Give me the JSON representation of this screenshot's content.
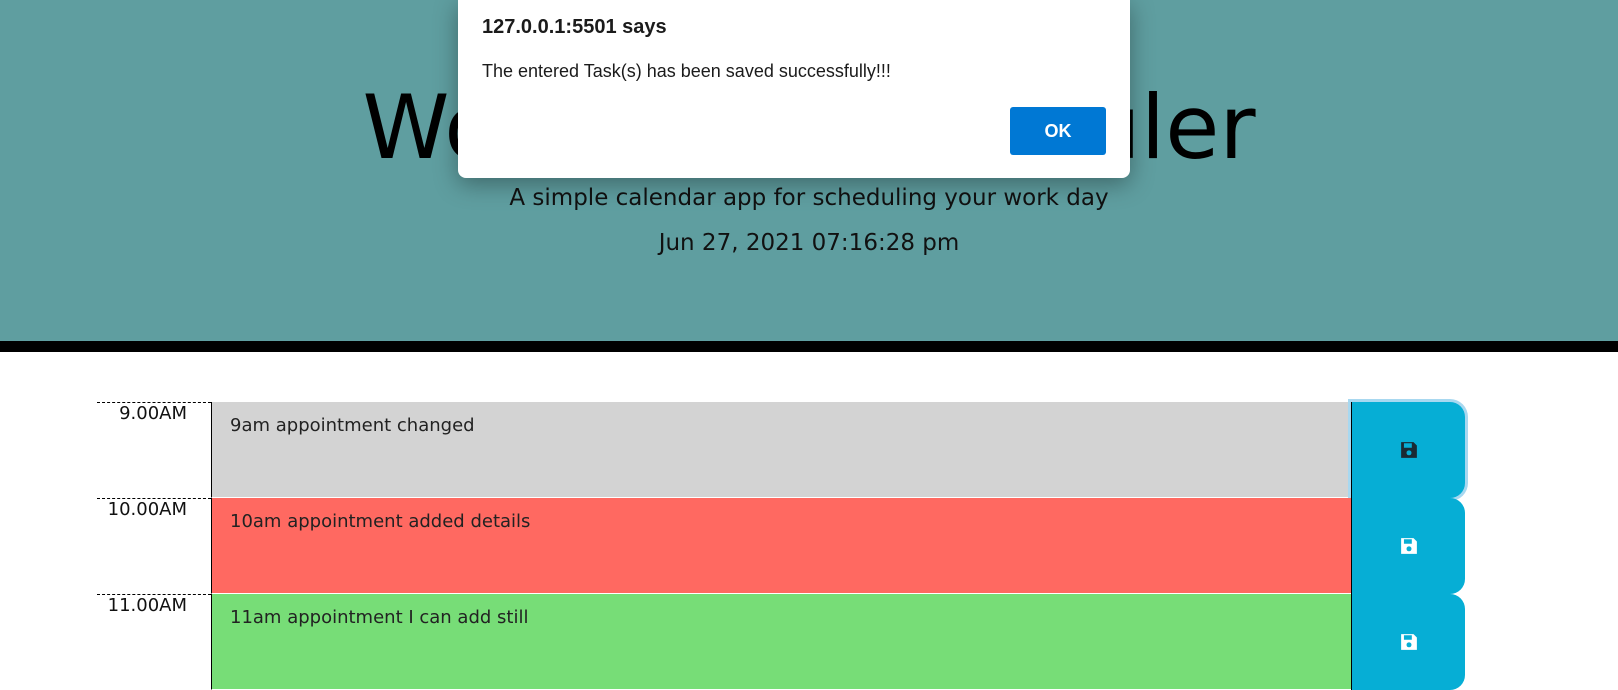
{
  "header": {
    "title": "Work Day Scheduler",
    "subtitle": "A simple calendar app for scheduling your work day",
    "current_datetime": "Jun 27, 2021 07:16:28 pm"
  },
  "dialog": {
    "title": "127.0.0.1:5501 says",
    "message": "The entered Task(s) has been saved successfully!!!",
    "ok_label": "OK",
    "accent_color": "#0078d4"
  },
  "colors": {
    "header_bg": "#5f9ea0",
    "past": "#d3d3d3",
    "present": "#ff6961",
    "future": "#77dd77",
    "save_button": "#06aed5"
  },
  "time_blocks": [
    {
      "hour": "9.00AM",
      "text": "9am appointment changed",
      "state": "past",
      "save_icon": "floppy-disk-icon"
    },
    {
      "hour": "10.00AM",
      "text": "10am appointment added details",
      "state": "present",
      "save_icon": "floppy-disk-icon"
    },
    {
      "hour": "11.00AM",
      "text": "11am appointment I can add still",
      "state": "future",
      "save_icon": "floppy-disk-icon"
    }
  ]
}
